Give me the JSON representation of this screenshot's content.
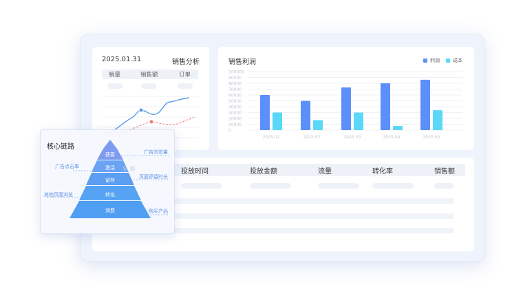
{
  "sales_card": {
    "date": "2025.01.31",
    "title": "销售分析",
    "metrics": [
      "销量",
      "销售额",
      "订单"
    ]
  },
  "profit_chart": {
    "title": "销售利润",
    "legend": [
      {
        "label": "利润",
        "color": "#5b8ff9"
      },
      {
        "label": "成本",
        "color": "#5ad8f7"
      }
    ]
  },
  "chart_data": {
    "type": "bar",
    "title": "销售利润",
    "categories": [
      "2025.01",
      "2025.02",
      "2025.03",
      "2025.04",
      "2025.05"
    ],
    "series": [
      {
        "name": "利润",
        "values": [
          60000,
          50000,
          73000,
          80000,
          86000
        ]
      },
      {
        "name": "成本",
        "values": [
          30000,
          17000,
          30000,
          7000,
          34000
        ]
      }
    ],
    "yticks": [
      "100000",
      "90000",
      "80000",
      "70000",
      "60000",
      "50000",
      "40000",
      "30000",
      "20000",
      "10000",
      "0"
    ],
    "ylim": [
      0,
      100000
    ],
    "grid": true,
    "legend_position": "top-right"
  },
  "table": {
    "columns": [
      "投放时间",
      "投放金额",
      "流量",
      "转化率",
      "销售额"
    ]
  },
  "funnel": {
    "title": "核心链路",
    "layers": [
      "获客",
      "激活",
      "留存",
      "转化",
      "消费"
    ],
    "annotations_right": [
      "广告浏览量",
      "页面停留时长",
      "购买产品"
    ],
    "annotations_left": [
      "广告点击率",
      "其他页面浏览"
    ],
    "watermark": "名 称"
  }
}
